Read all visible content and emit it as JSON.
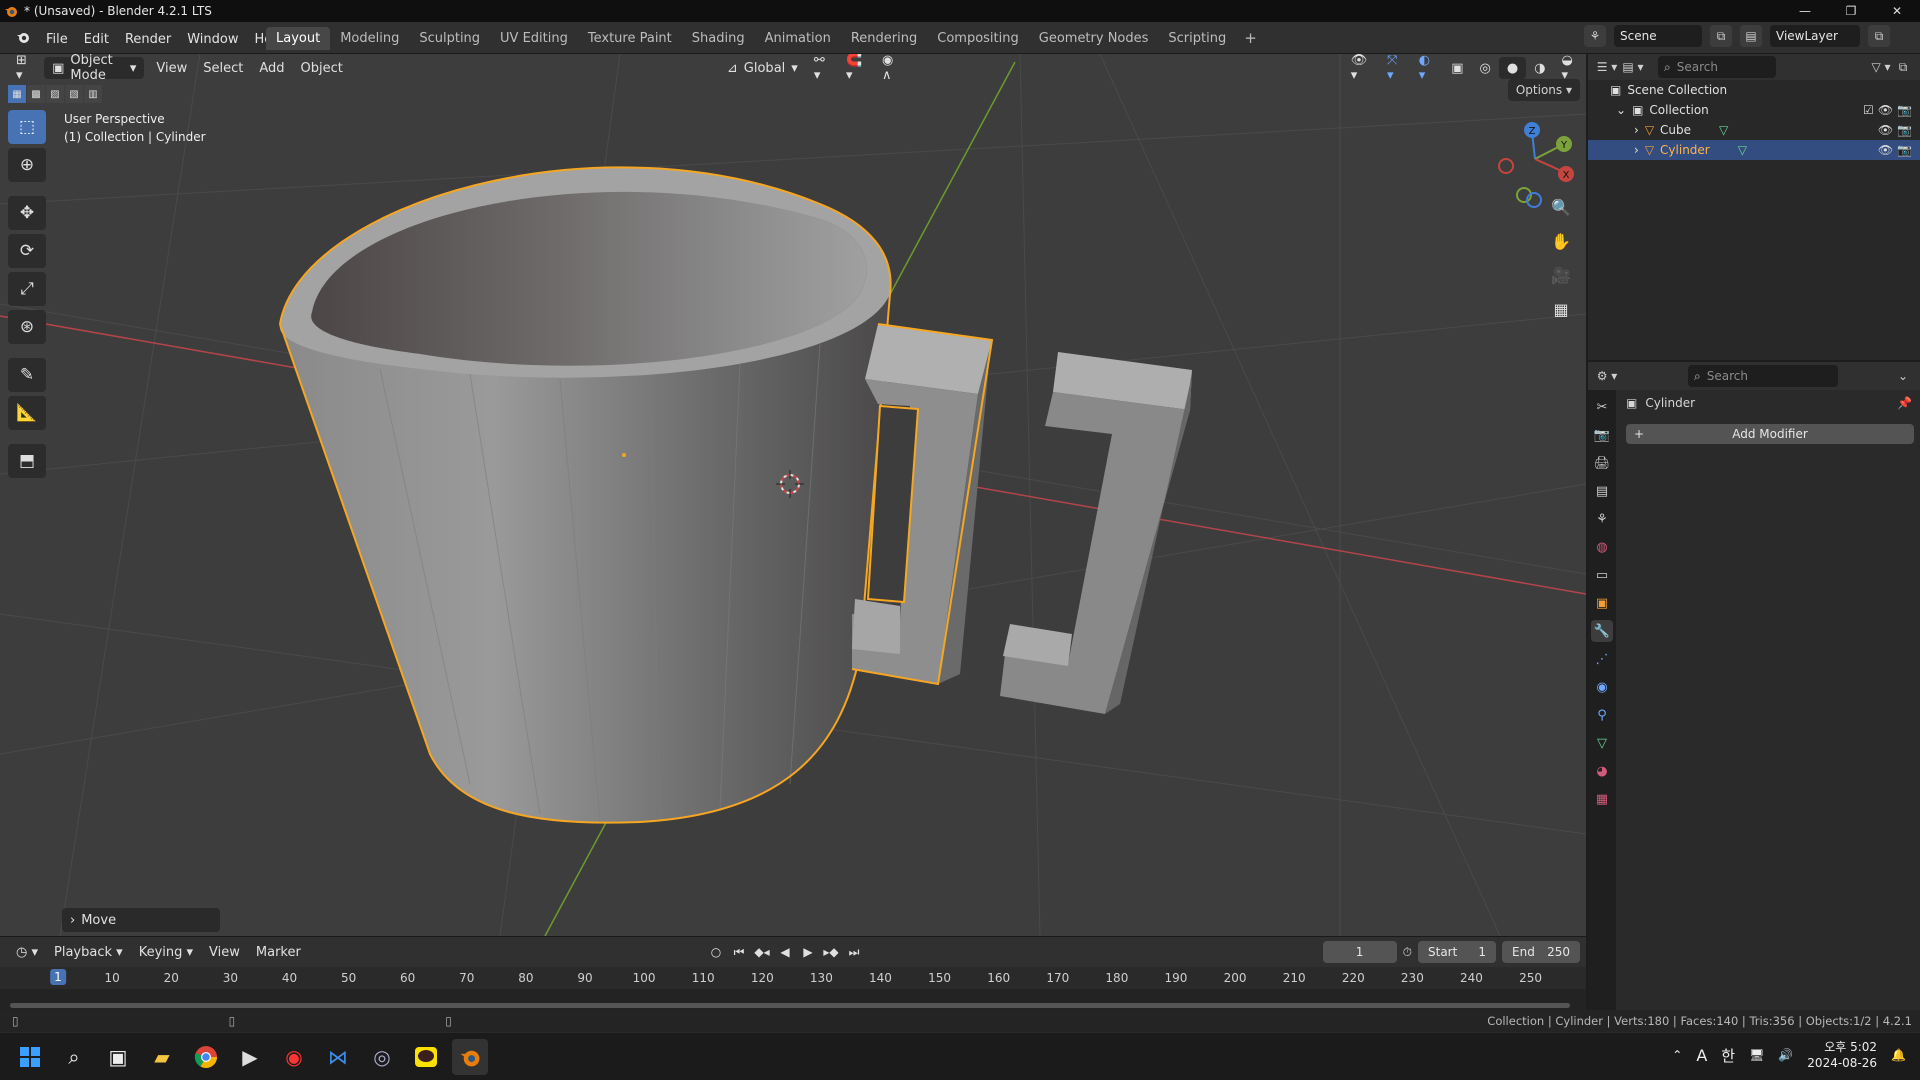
{
  "window": {
    "title": "* (Unsaved) - Blender 4.2.1 LTS"
  },
  "menus": [
    "File",
    "Edit",
    "Render",
    "Window",
    "Help"
  ],
  "workspaces": [
    "Layout",
    "Modeling",
    "Sculpting",
    "UV Editing",
    "Texture Paint",
    "Shading",
    "Animation",
    "Rendering",
    "Compositing",
    "Geometry Nodes",
    "Scripting"
  ],
  "active_workspace": "Layout",
  "scene": {
    "name": "Scene",
    "view_layer": "ViewLayer"
  },
  "viewport": {
    "mode": "Object Mode",
    "menus": [
      "View",
      "Select",
      "Add",
      "Object"
    ],
    "orientation": "Global",
    "options_label": "Options",
    "info_line1": "User Perspective",
    "info_line2": "(1) Collection | Cylinder",
    "last_operator": "Move",
    "gizmo_axes": {
      "x": "X",
      "y": "Y",
      "z": "Z"
    }
  },
  "outliner": {
    "search_placeholder": "Search",
    "scene_collection": "Scene Collection",
    "collection": "Collection",
    "objects": [
      {
        "name": "Cube",
        "selected": false
      },
      {
        "name": "Cylinder",
        "selected": true
      }
    ]
  },
  "properties": {
    "search_placeholder": "Search",
    "object_name": "Cylinder",
    "add_modifier_label": "Add Modifier"
  },
  "timeline": {
    "menus": [
      "Playback",
      "Keying",
      "View",
      "Marker"
    ],
    "current_frame": "1",
    "start_label": "Start",
    "start": "1",
    "end_label": "End",
    "end": "250",
    "ruler_ticks": [
      "1",
      "10",
      "20",
      "30",
      "40",
      "50",
      "60",
      "70",
      "80",
      "90",
      "100",
      "110",
      "120",
      "130",
      "140",
      "150",
      "160",
      "170",
      "180",
      "190",
      "200",
      "210",
      "220",
      "230",
      "240",
      "250"
    ]
  },
  "status_bar": {
    "stats": "Collection | Cylinder | Verts:180 | Faces:140 | Tris:356 | Objects:1/2 | 4.2.1"
  },
  "taskbar": {
    "clock_time": "오후 5:02",
    "clock_date": "2024-08-26",
    "ime_label": "A",
    "ime_lang": "한"
  },
  "colors": {
    "accent": "#4772b3",
    "selection_outline": "#f5a623",
    "x_axis": "#c6453f",
    "y_axis": "#7ca33b",
    "z_axis": "#3f7fd6"
  }
}
